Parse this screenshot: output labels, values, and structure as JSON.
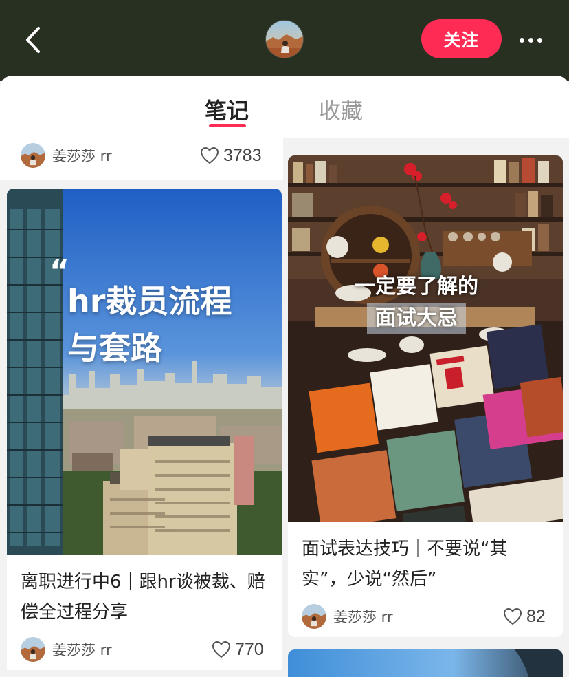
{
  "header": {
    "follow_label": "关注"
  },
  "tabs": [
    {
      "label": "笔记",
      "active": true
    },
    {
      "label": "收藏",
      "active": false
    }
  ],
  "accent_color": "#fe2c55",
  "header_bg_color": "#283022",
  "feed": [
    {
      "author": "姜莎莎 rr",
      "likes": "3783"
    },
    {
      "cover_text_line1": "hr裁员流程",
      "cover_text_line2": "与套路",
      "title": "离职进行中6｜跟hr谈被裁、赔偿全过程分享",
      "author": "姜莎莎 rr",
      "likes": "770"
    },
    {
      "cover_text_line1": "一定要了解的",
      "cover_text_line2": "面试大忌",
      "title": "面试表达技巧｜不要说“其实”，少说“然后”",
      "author": "姜莎莎 rr",
      "likes": "82"
    }
  ]
}
